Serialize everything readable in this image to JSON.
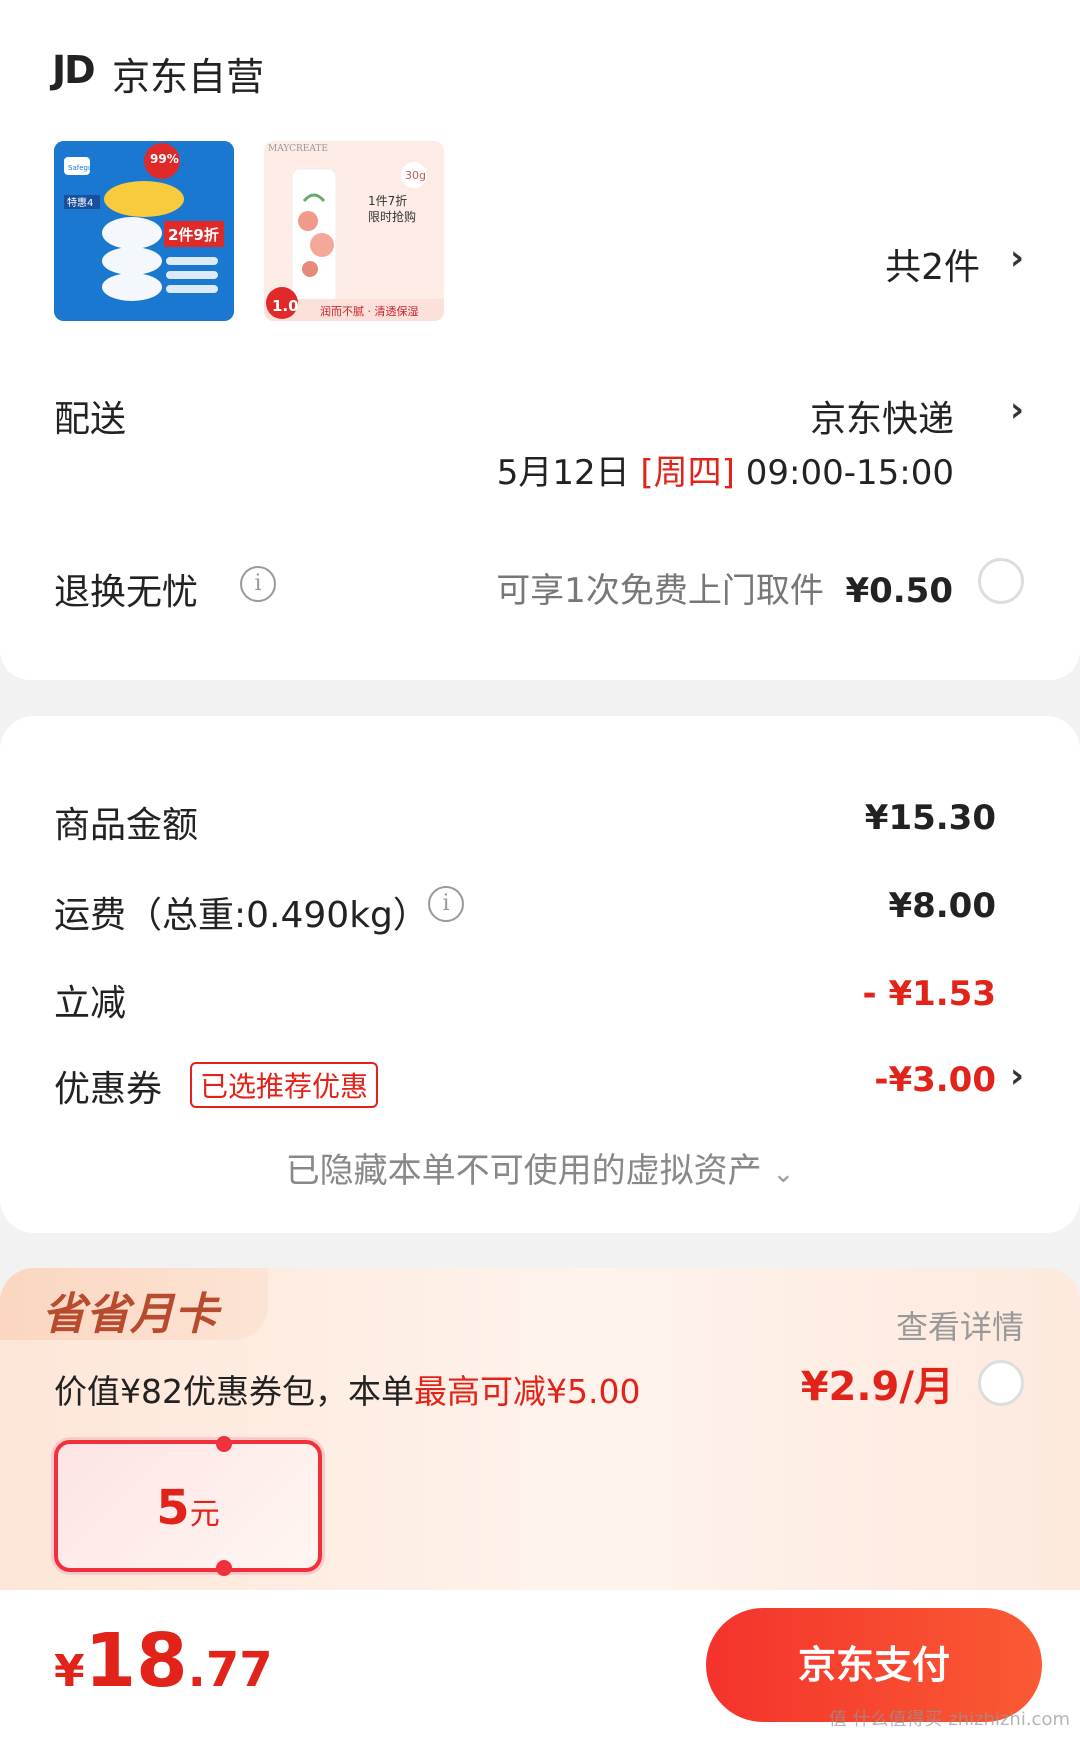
{
  "store": {
    "logo_text": "JD",
    "name": "京东自营",
    "product_count": "共2件",
    "products": [
      {
        "image_text": [
          "Safeguard",
          "99%",
          "特惠4",
          "2件9折"
        ]
      },
      {
        "image_text": [
          "MAYCREATE",
          "30g",
          "1件7折",
          "限时抢购",
          "1.0",
          "润而不腻 · 清透保湿"
        ]
      }
    ]
  },
  "delivery": {
    "label": "配送",
    "method": "京东快递",
    "date": "5月12日",
    "weekday": "[周四]",
    "time": "09:00-15:00"
  },
  "return_service": {
    "label": "退换无忧",
    "note": "可享1次免费上门取件",
    "price": "¥0.50"
  },
  "price_summary": {
    "goods_label": "商品金额",
    "goods_amount": "¥15.30",
    "shipping_label": "运费（总重:0.490kg）",
    "shipping_amount": "¥8.00",
    "discount_label": "立减",
    "discount_amount": "- ¥1.53",
    "coupon_label": "优惠券",
    "coupon_badge": "已选推荐优惠",
    "coupon_amount": "-¥3.00",
    "hidden_note": "已隐藏本单不可使用的虚拟资产"
  },
  "savings_card": {
    "title": "省省月卡",
    "detail_link": "查看详情",
    "desc_prefix": "价值¥82优惠券包，本单",
    "desc_highlight": "最高可减¥5.00",
    "price": "¥2.9/月",
    "coupon_value": "5",
    "coupon_unit": "元"
  },
  "bottom_bar": {
    "currency": "¥",
    "total_int": "18",
    "total_dec": ".77",
    "pay_button": "京东支付",
    "watermark": "值 什么值得买 zhizhizhi.com"
  },
  "colors": {
    "accent_red": "#e2231a",
    "pay_button": "#f4332c"
  }
}
